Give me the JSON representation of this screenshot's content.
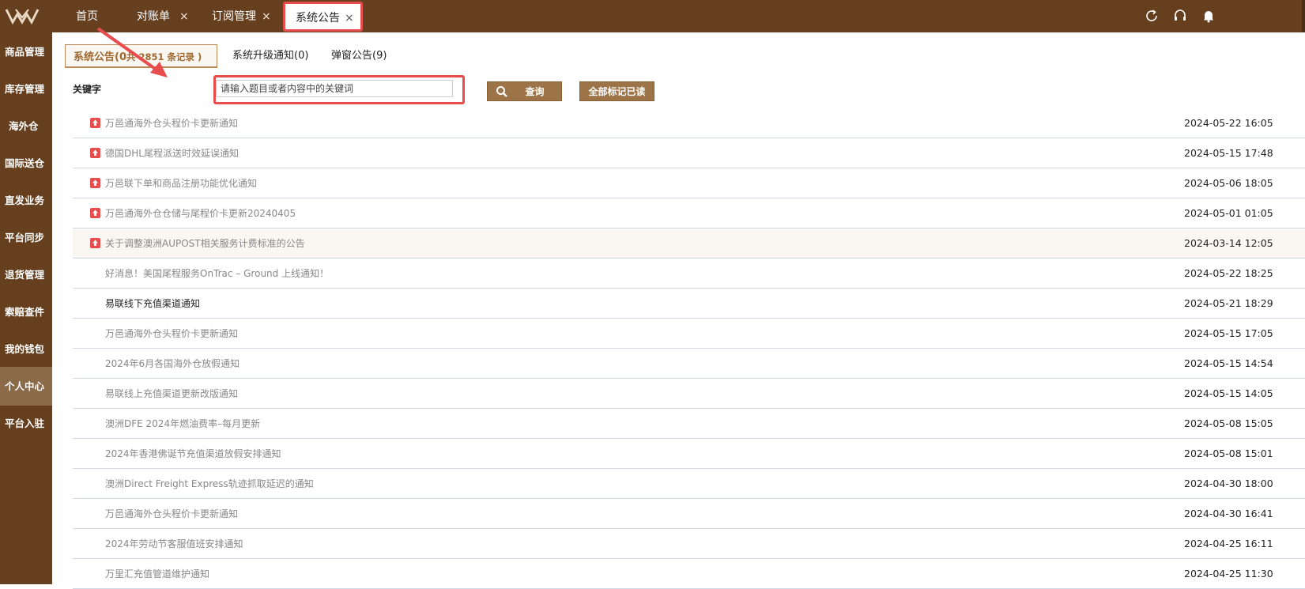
{
  "topbar": {
    "logo_icon": "brand-logo-icon",
    "tabs": [
      {
        "label": "首页",
        "closable": false
      },
      {
        "label": "对账单",
        "closable": true
      },
      {
        "label": "订阅管理",
        "closable": true
      },
      {
        "label": "系统公告",
        "closable": true,
        "active": true
      }
    ],
    "close_glyph": "×",
    "icons": [
      "refresh-icon",
      "headset-icon",
      "bell-icon"
    ]
  },
  "sidebar": {
    "items": [
      {
        "label": "商品管理"
      },
      {
        "label": "库存管理"
      },
      {
        "label": "海外仓"
      },
      {
        "label": "国际送仓"
      },
      {
        "label": "直发业务"
      },
      {
        "label": "平台同步"
      },
      {
        "label": "退货管理"
      },
      {
        "label": "索赔查件"
      },
      {
        "label": "我的钱包"
      },
      {
        "label": "个人中心",
        "active": true
      },
      {
        "label": "平台入驻"
      }
    ]
  },
  "subtabs": [
    {
      "label": "系统公告(0",
      "count_text": "共 2851 条记录 )",
      "active": true
    },
    {
      "label": "系统升级通知(0)"
    },
    {
      "label": "弹窗公告(9)"
    }
  ],
  "search": {
    "keyword_label": "关键字",
    "placeholder": "请输入题目或者内容中的关键词",
    "query_button": "查询",
    "mark_all_button": "全部标记已读"
  },
  "notices": [
    {
      "title": "万邑通海外仓头程价卡更新通知",
      "date": "2024-05-22 16:05",
      "pinned": true
    },
    {
      "title": "德国DHL尾程派送时效延误通知",
      "date": "2024-05-15 17:48",
      "pinned": true
    },
    {
      "title": "万邑联下单和商品注册功能优化通知",
      "date": "2024-05-06 18:05",
      "pinned": true
    },
    {
      "title": "万邑通海外仓仓储与尾程价卡更新20240405",
      "date": "2024-05-01 01:05",
      "pinned": true
    },
    {
      "title": "关于调整澳洲AUPOST相关服务计费标准的公告",
      "date": "2024-03-14 12:05",
      "pinned": true,
      "selected": true
    },
    {
      "title": "好消息！美国尾程服务OnTrac – Ground 上线通知！",
      "date": "2024-05-22 18:25"
    },
    {
      "title": "易联线下充值渠道通知",
      "date": "2024-05-21 18:29",
      "unread": true
    },
    {
      "title": "万邑通海外仓头程价卡更新通知",
      "date": "2024-05-15 17:05"
    },
    {
      "title": "2024年6月各国海外仓放假通知",
      "date": "2024-05-15 14:54"
    },
    {
      "title": "易联线上充值渠道更新改版通知",
      "date": "2024-05-15 14:05"
    },
    {
      "title": "澳洲DFE 2024年燃油费率–每月更新",
      "date": "2024-05-08 15:05"
    },
    {
      "title": "2024年香港佛诞节充值渠道放假安排通知",
      "date": "2024-05-08 15:01"
    },
    {
      "title": "澳洲Direct Freight Express轨迹抓取延迟的通知",
      "date": "2024-04-30 18:00"
    },
    {
      "title": "万邑通海外仓头程价卡更新通知",
      "date": "2024-04-30 16:41"
    },
    {
      "title": "2024年劳动节客服值班安排通知",
      "date": "2024-04-25 16:11"
    },
    {
      "title": "万里汇充值管道维护通知",
      "date": "2024-04-25 11:30"
    }
  ],
  "colors": {
    "brand": "#653f1e",
    "accent": "#9c7447",
    "highlight": "#e74d4d"
  }
}
